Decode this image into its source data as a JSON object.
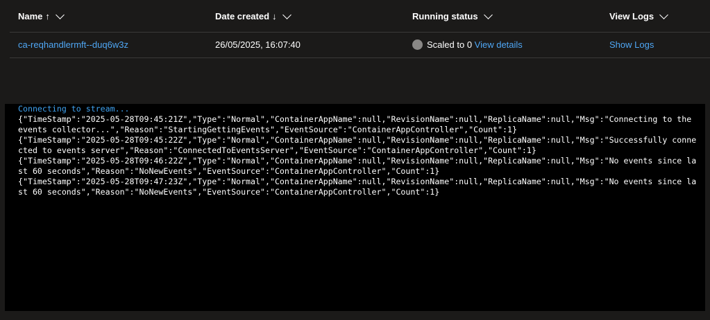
{
  "table": {
    "headers": {
      "name": {
        "label": "Name",
        "sort_arrow": "↑"
      },
      "date": {
        "label": "Date created",
        "sort_arrow": "↓"
      },
      "status": {
        "label": "Running status"
      },
      "logs": {
        "label": "View Logs"
      }
    },
    "rows": [
      {
        "name": "ca-reqhandlermft--duq6w3z",
        "date_created": "26/05/2025, 16:07:40",
        "status_text": "Scaled to 0",
        "view_details": "View details",
        "show_logs": "Show Logs"
      }
    ]
  },
  "console": {
    "status": "Connecting to stream...",
    "lines": [
      "{\"TimeStamp\":\"2025-05-28T09:45:21Z\",\"Type\":\"Normal\",\"ContainerAppName\":null,\"RevisionName\":null,\"ReplicaName\":null,\"Msg\":\"Connecting to the events collector...\",\"Reason\":\"StartingGettingEvents\",\"EventSource\":\"ContainerAppController\",\"Count\":1}",
      "{\"TimeStamp\":\"2025-05-28T09:45:22Z\",\"Type\":\"Normal\",\"ContainerAppName\":null,\"RevisionName\":null,\"ReplicaName\":null,\"Msg\":\"Successfully connected to events server\",\"Reason\":\"ConnectedToEventsServer\",\"EventSource\":\"ContainerAppController\",\"Count\":1}",
      "{\"TimeStamp\":\"2025-05-28T09:46:22Z\",\"Type\":\"Normal\",\"ContainerAppName\":null,\"RevisionName\":null,\"ReplicaName\":null,\"Msg\":\"No events since last 60 seconds\",\"Reason\":\"NoNewEvents\",\"EventSource\":\"ContainerAppController\",\"Count\":1}",
      "{\"TimeStamp\":\"2025-05-28T09:47:23Z\",\"Type\":\"Normal\",\"ContainerAppName\":null,\"RevisionName\":null,\"ReplicaName\":null,\"Msg\":\"No events since last 60 seconds\",\"Reason\":\"NoNewEvents\",\"EventSource\":\"ContainerAppController\",\"Count\":1}"
    ]
  },
  "colors": {
    "background": "#1b1a19",
    "console_bg": "#000000",
    "link": "#4fa7f5",
    "console_status": "#3fa2f0",
    "status_dot": "#8a8886",
    "divider": "#3b3a39"
  },
  "icons": {
    "sort_menu": "chevron-down-icon",
    "status": "status-circle-icon"
  }
}
